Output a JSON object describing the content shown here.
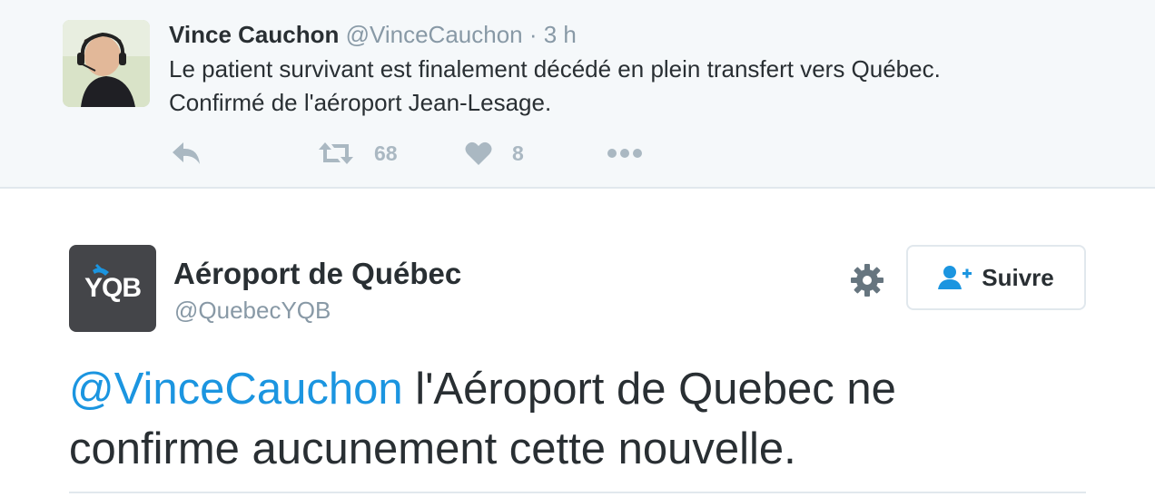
{
  "quoted_tweet": {
    "author_name": "Vince Cauchon",
    "handle": "@VinceCauchon",
    "separator": " · ",
    "time": "3 h",
    "text_line1": "Le patient survivant est finalement décédé en plein transfert vers Québec.",
    "text_line2": "Confirmé de l'aéroport Jean-Lesage.",
    "retweet_count": "68",
    "like_count": "8"
  },
  "main_tweet": {
    "avatar_text": "YQB",
    "author_name": "Aéroport de Québec",
    "handle": "@QuebecYQB",
    "follow_label": "Suivre",
    "mention": "@VinceCauchon",
    "text_part1": " l'Aéroport de Quebec ne",
    "text_line2": "confirme aucunement cette nouvelle."
  },
  "colors": {
    "link": "#1b95e0",
    "action_gray": "#aab8c2",
    "text": "#292f33",
    "follow_icon": "#1b95e0"
  }
}
